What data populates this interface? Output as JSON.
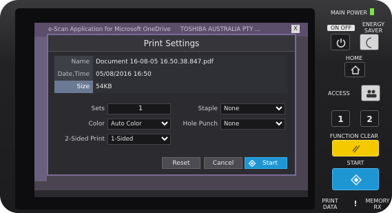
{
  "background_window": {
    "title_left": "e-Scan Application for Microsoft OneDrive",
    "title_right": "TOSHIBA AUSTRALIA PTY ...",
    "close": "X"
  },
  "dialog": {
    "title": "Print Settings",
    "info": [
      {
        "label": "Name",
        "value": "Document 16-08-05 16.50.38.847.pdf"
      },
      {
        "label": "Date,Time",
        "value": "05/08/2016 16:50"
      },
      {
        "label": "Size",
        "value": "54KB"
      }
    ],
    "sets": {
      "label": "Sets",
      "value": "1"
    },
    "color": {
      "label": "Color",
      "value": "Auto Color"
    },
    "two_sided": {
      "label": "2-Sided Print",
      "value": "1-Sided"
    },
    "staple": {
      "label": "Staple",
      "value": "None"
    },
    "hole_punch": {
      "label": "Hole Punch",
      "value": "None"
    },
    "buttons": {
      "reset": "Reset",
      "cancel": "Cancel",
      "start": "Start"
    }
  },
  "panel": {
    "main_power": "MAIN POWER",
    "on_off": "ON OFF",
    "energy_saver_1": "ENERGY",
    "energy_saver_2": "SAVER",
    "home": "HOME",
    "access": "ACCESS",
    "one": "1",
    "two": "2",
    "function_clear": "FUNCTION CLEAR",
    "start": "START",
    "print_data_1": "PRINT",
    "print_data_2": "DATA",
    "alert": "!",
    "memory_rx_1": "MEMORY",
    "memory_rx_2": "RX",
    "colors": {
      "led": "#7ee04a",
      "clear": "#f5c900",
      "start": "#1e96d4"
    }
  }
}
